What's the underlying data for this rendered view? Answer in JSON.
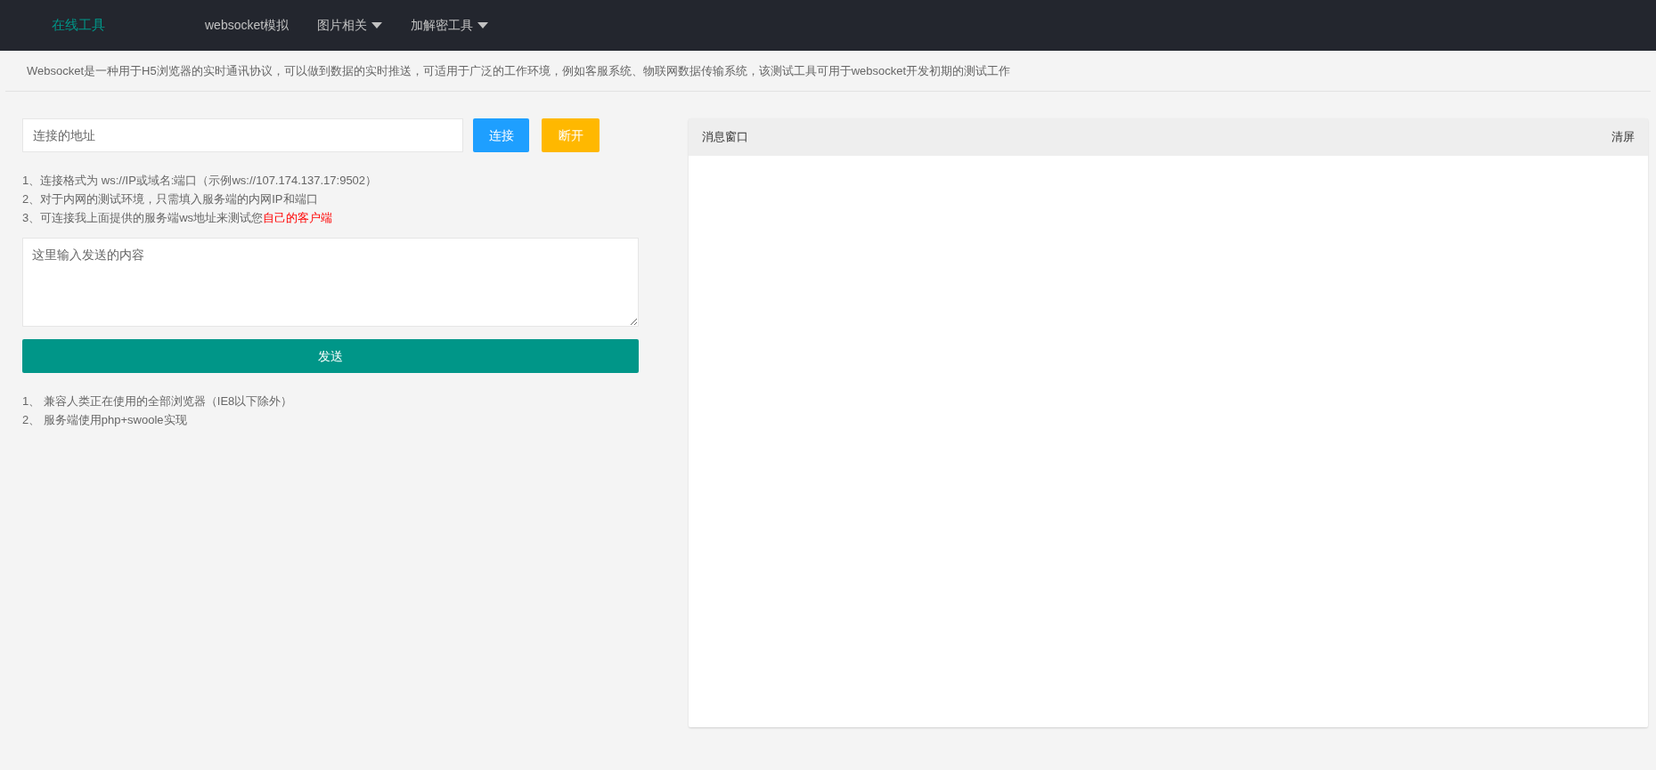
{
  "navbar": {
    "logo": "在线工具",
    "items": [
      {
        "label": "websocket模拟",
        "dropdown": false
      },
      {
        "label": "图片相关",
        "dropdown": true
      },
      {
        "label": "加解密工具",
        "dropdown": true
      }
    ]
  },
  "intro": "Websocket是一种用于H5浏览器的实时通讯协议，可以做到数据的实时推送，可适用于广泛的工作环境，例如客服系统、物联网数据传输系统，该测试工具可用于websocket开发初期的测试工作",
  "connect": {
    "placeholder": "连接的地址",
    "connect_button": "连接",
    "disconnect_button": "断开"
  },
  "hints": [
    {
      "text": "1、连接格式为 ws://IP或域名:端口（示例ws://107.174.137.17:9502）"
    },
    {
      "text": "2、对于内网的测试环境，只需填入服务端的内网IP和端口"
    },
    {
      "text": "3、可连接我上面提供的服务端ws地址来测试您",
      "highlight": "自己的客户端"
    }
  ],
  "message_input": {
    "placeholder": "这里输入发送的内容"
  },
  "send_button": "发送",
  "notes": [
    "1、 兼容人类正在使用的全部浏览器（IE8以下除外）",
    "2、 服务端使用php+swoole实现"
  ],
  "message_window": {
    "title": "消息窗口",
    "clear_button": "清屏"
  }
}
